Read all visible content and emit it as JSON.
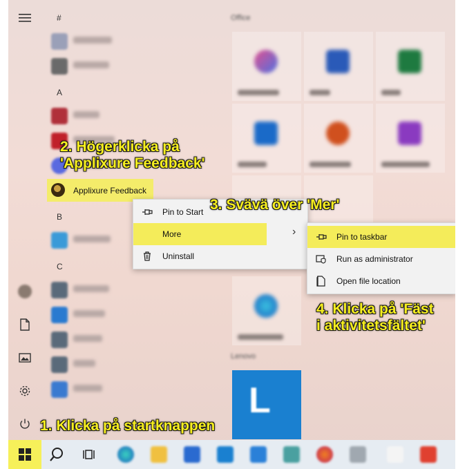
{
  "colors": {
    "highlight": "#f4ec5a",
    "annotation_text": "#f7ef1f",
    "menu_bg": "#f2f2f2"
  },
  "app_list": {
    "letters": [
      "#",
      "A",
      "B",
      "C"
    ],
    "selected_app": "Applixure Feedback"
  },
  "tiles": {
    "group_office": "Office",
    "group_lenovo": "Lenovo"
  },
  "context_menu": {
    "items": [
      {
        "icon": "pin-icon",
        "label": "Pin to Start"
      },
      {
        "icon": "more-icon",
        "label": "More",
        "chevron": "›"
      },
      {
        "icon": "trash-icon",
        "label": "Uninstall"
      }
    ]
  },
  "submenu": {
    "items": [
      {
        "icon": "pin-icon",
        "label": "Pin to taskbar"
      },
      {
        "icon": "shield-icon",
        "label": "Run as administrator"
      },
      {
        "icon": "folder-icon",
        "label": "Open file location"
      }
    ]
  },
  "annotations": {
    "step1": "1. Klicka på startknappen",
    "step2_line1": "2. Högerklicka på",
    "step2_line2": "'Applixure Feedback'",
    "step3": "3. Svävä över 'Mer'",
    "step4_line1": "4. Klicka på 'Fäst",
    "step4_line2": "i aktivitetsfältet'"
  },
  "taskbar": {
    "icons": [
      "start-icon",
      "search-icon",
      "task-view-icon"
    ]
  }
}
